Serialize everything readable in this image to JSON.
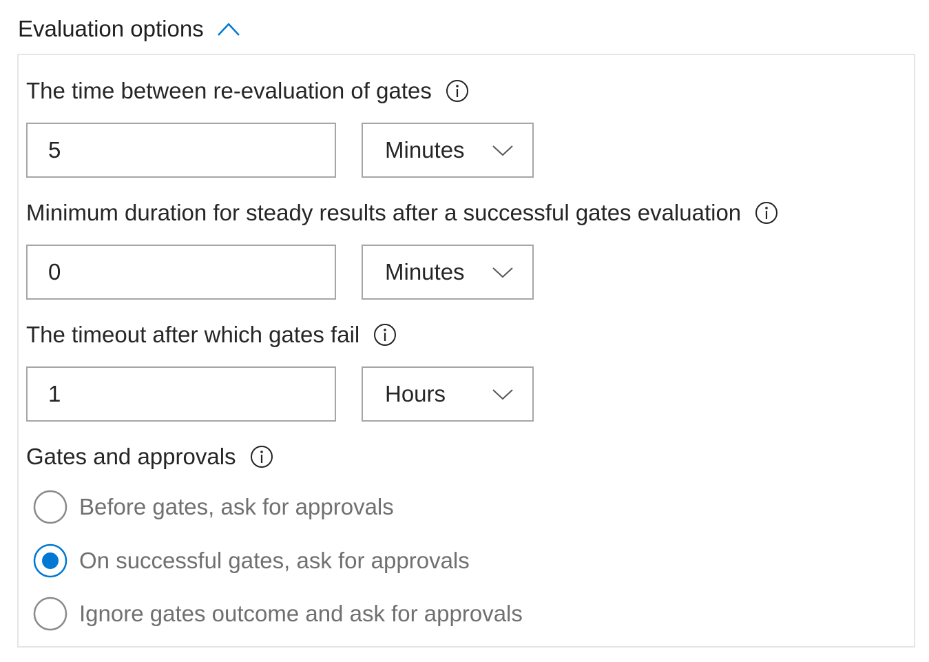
{
  "section": {
    "title": "Evaluation options",
    "expanded": true
  },
  "reevaluation": {
    "label": "The time between re-evaluation of gates",
    "value": "5",
    "unit": "Minutes"
  },
  "steady_duration": {
    "label": "Minimum duration for steady results after a successful gates evaluation",
    "value": "0",
    "unit": "Minutes"
  },
  "timeout": {
    "label": "The timeout after which gates fail",
    "value": "1",
    "unit": "Hours"
  },
  "gates_approvals": {
    "label": "Gates and approvals",
    "selected_index": 1,
    "options": [
      {
        "label": "Before gates, ask for approvals",
        "selected": false
      },
      {
        "label": "On successful gates, ask for approvals",
        "selected": true
      },
      {
        "label": "Ignore gates outcome and ask for approvals",
        "selected": false
      }
    ]
  },
  "colors": {
    "accent": "#0078d4",
    "border": "#a6a6a6",
    "panel_border": "#e5e5e5",
    "muted_text": "#707070"
  },
  "icons": {
    "collapse": "chevron-up-icon",
    "dropdown": "chevron-down-icon",
    "info": "info-icon"
  }
}
